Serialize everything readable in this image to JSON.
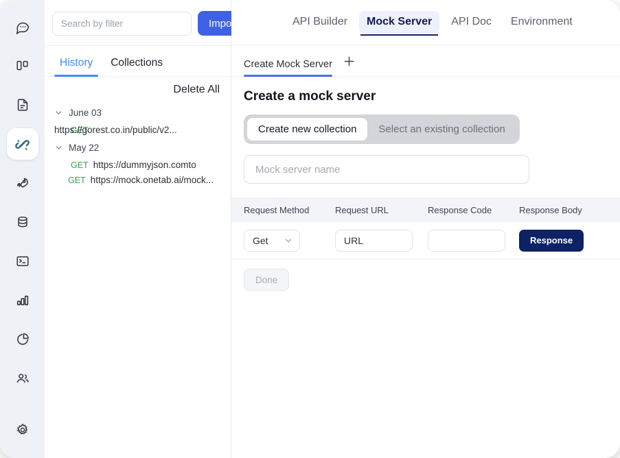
{
  "rail": {
    "items": [
      {
        "name": "chat-icon",
        "label": "Chat"
      },
      {
        "name": "board-icon",
        "label": "Board"
      },
      {
        "name": "document-icon",
        "label": "Document"
      },
      {
        "name": "plug-icon",
        "label": "API Connect",
        "active": true
      },
      {
        "name": "rocket-icon",
        "label": "Launch"
      },
      {
        "name": "database-icon",
        "label": "Database"
      },
      {
        "name": "terminal-icon",
        "label": "Terminal"
      },
      {
        "name": "bar-chart-icon",
        "label": "Analytics"
      },
      {
        "name": "pie-chart-icon",
        "label": "Reports"
      },
      {
        "name": "users-icon",
        "label": "Team"
      }
    ],
    "settings": {
      "name": "gear-icon",
      "label": "Settings"
    },
    "active_color": "#2a6b78"
  },
  "left_panel": {
    "search": {
      "placeholder": "Search by filter",
      "value": ""
    },
    "import_label": "Import",
    "import_color": "#3f62e4",
    "tabs": [
      {
        "label": "History",
        "active": true
      },
      {
        "label": "Collections",
        "active": false
      }
    ],
    "delete_all_label": "Delete All",
    "groups": [
      {
        "label": "June 03",
        "items": [
          {
            "method": "GET",
            "url": "https://gorest.co.in/public/v2...",
            "style": "overlap"
          }
        ]
      },
      {
        "label": "May 22",
        "items": [
          {
            "method": "GET",
            "url": "https://dummyjson.comtodos",
            "style": "wrap"
          },
          {
            "method": "GET",
            "url": "https://mock.onetab.ai/mock...",
            "style": "ellip"
          }
        ]
      }
    ],
    "method_color": "#3ea05a"
  },
  "top_tabs": [
    {
      "label": "API Builder",
      "active": false
    },
    {
      "label": "Mock Server",
      "active": true
    },
    {
      "label": "API Doc",
      "active": false
    },
    {
      "label": "Environment",
      "active": false
    }
  ],
  "sub_tabs": {
    "tabs": [
      {
        "label": "Create Mock Server",
        "active": true
      }
    ],
    "add_label": "+",
    "underline_color": "#4a6cf0"
  },
  "pane": {
    "title": "Create a mock server",
    "segmented": [
      {
        "label": "Create new collection",
        "active": true
      },
      {
        "label": "Select an existing collection",
        "active": false
      }
    ],
    "name_input": {
      "placeholder": "Mock server name",
      "value": ""
    },
    "table": {
      "headers": [
        "Request Method",
        "Request URL",
        "Response Code",
        "Response Body"
      ],
      "rows": [
        {
          "method": "Get",
          "url_placeholder": "URL",
          "url_value": "URL",
          "response_code": "",
          "response_code_placeholder": "",
          "response_button": "Response",
          "response_button_color": "#0d2265"
        }
      ]
    },
    "done_label": "Done"
  }
}
